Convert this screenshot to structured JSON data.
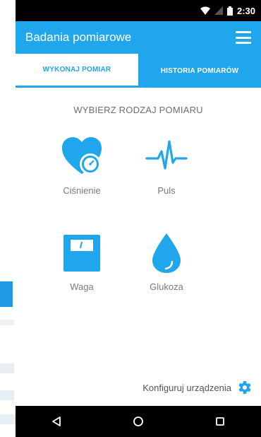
{
  "status_bar": {
    "time": "2:30"
  },
  "app_bar": {
    "title": "Badania pomiarowe"
  },
  "tabs": [
    {
      "label": "WYKONAJ POMIAR",
      "active": true
    },
    {
      "label": "HISTORIA POMIARÓW",
      "active": false
    }
  ],
  "prompt": "WYBIERZ RODZAJ POMIARU",
  "measurements": [
    {
      "label": "Ciśnienie",
      "icon": "blood-pressure-heart-icon"
    },
    {
      "label": "Puls",
      "icon": "pulse-wave-icon"
    },
    {
      "label": "Waga",
      "icon": "scale-icon"
    },
    {
      "label": "Glukoza",
      "icon": "glucose-drop-icon"
    }
  ],
  "config": {
    "label": "Konfiguruj urządzenia",
    "icon": "gear-icon"
  },
  "colors": {
    "primary": "#1fa6ec",
    "text_muted": "#7a7a7a"
  }
}
